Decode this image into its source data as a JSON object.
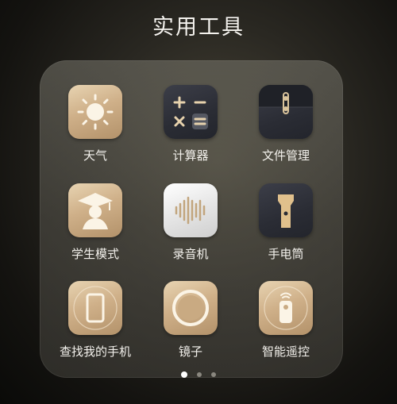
{
  "folder": {
    "title": "实用工具"
  },
  "apps": [
    {
      "label": "天气",
      "icon": "weather-sun-icon"
    },
    {
      "label": "计算器",
      "icon": "calculator-icon"
    },
    {
      "label": "文件管理",
      "icon": "file-folder-icon"
    },
    {
      "label": "学生模式",
      "icon": "graduation-cap-icon"
    },
    {
      "label": "录音机",
      "icon": "sound-wave-icon"
    },
    {
      "label": "手电筒",
      "icon": "flashlight-icon"
    },
    {
      "label": "查找我的手机",
      "icon": "phone-outline-icon"
    },
    {
      "label": "镜子",
      "icon": "mirror-ring-icon"
    },
    {
      "label": "智能遥控",
      "icon": "remote-control-icon"
    }
  ],
  "pager": {
    "page_count": 3,
    "current_page": 1
  },
  "colors": {
    "gold": "#cfb089",
    "dark": "#2a2c34",
    "silver": "#e6e6e6"
  }
}
